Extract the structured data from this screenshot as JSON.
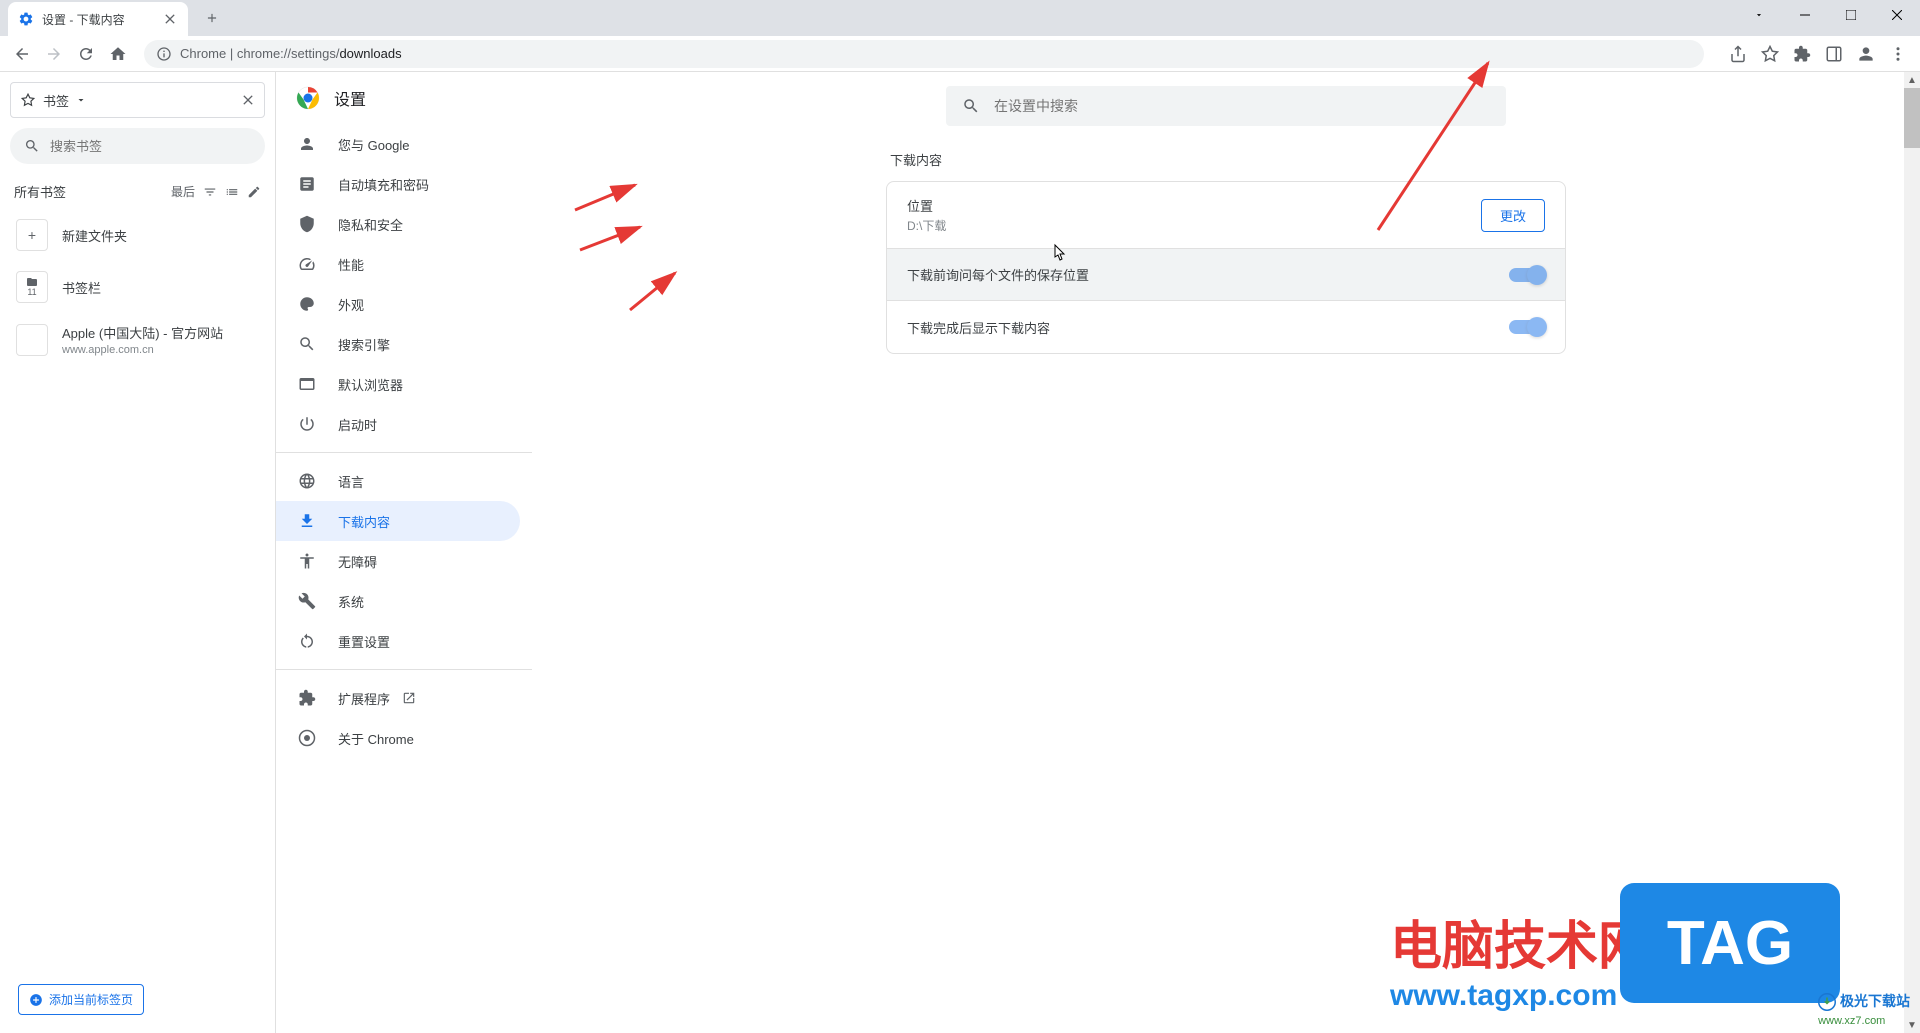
{
  "window": {
    "tab_title": "设置 - 下载内容",
    "url_prefix": "Chrome | chrome://settings/",
    "url_path": "downloads"
  },
  "bookmarks": {
    "header_label": "书签",
    "search_placeholder": "搜索书签",
    "all_label": "所有书签",
    "sort_label": "最后",
    "new_folder": "新建文件夹",
    "bar_label": "书签栏",
    "bar_count": "11",
    "items": [
      {
        "title": "Apple (中国大陆) - 官方网站",
        "url": "www.apple.com.cn",
        "icon": ""
      }
    ],
    "add_current": "添加当前标签页"
  },
  "settings": {
    "title": "设置",
    "search_placeholder": "在设置中搜索",
    "nav": [
      {
        "label": "您与 Google"
      },
      {
        "label": "自动填充和密码"
      },
      {
        "label": "隐私和安全"
      },
      {
        "label": "性能"
      },
      {
        "label": "外观"
      },
      {
        "label": "搜索引擎"
      },
      {
        "label": "默认浏览器"
      },
      {
        "label": "启动时"
      }
    ],
    "nav2": [
      {
        "label": "语言"
      },
      {
        "label": "下载内容"
      },
      {
        "label": "无障碍"
      },
      {
        "label": "系统"
      },
      {
        "label": "重置设置"
      }
    ],
    "nav3": [
      {
        "label": "扩展程序"
      },
      {
        "label": "关于 Chrome"
      }
    ]
  },
  "downloads": {
    "section_title": "下载内容",
    "location_label": "位置",
    "location_value": "D:\\下载",
    "change_btn": "更改",
    "ask_each_label": "下载前询问每个文件的保存位置",
    "show_complete_label": "下载完成后显示下载内容"
  },
  "watermark": {
    "site_cn": "电脑技术网",
    "site_url": "www.tagxp.com",
    "tag": "TAG",
    "dl_site": "极光下载站",
    "dl_url": "www.xz7.com"
  }
}
